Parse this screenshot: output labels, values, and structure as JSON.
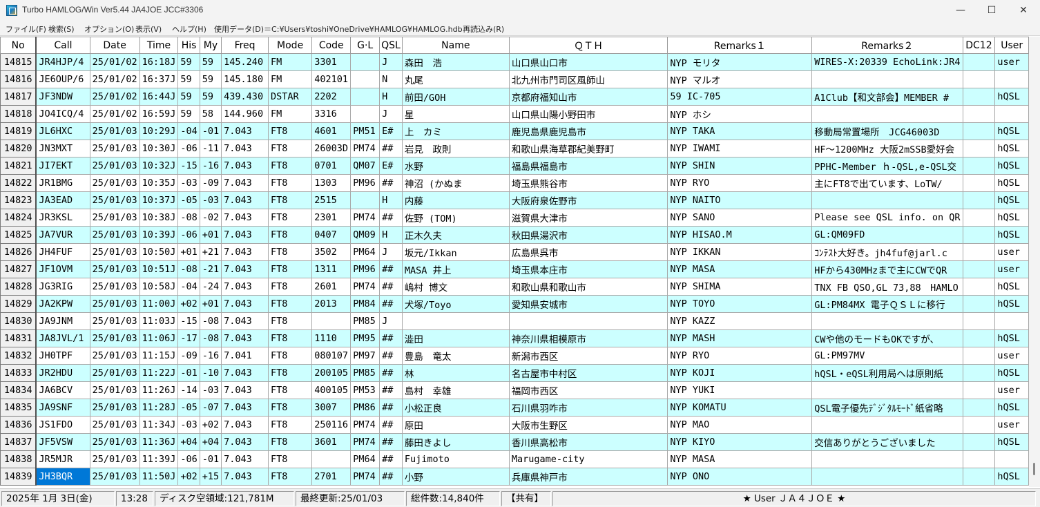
{
  "window": {
    "title": "Turbo HAMLOG/Win Ver5.44 JA4JOE JCC#3306",
    "minimize_glyph": "—",
    "maximize_glyph": "☐",
    "close_glyph": "✕"
  },
  "menu": [
    "ファイル(F)",
    "検索(S)",
    "オプション(O)",
    "表示(V)",
    "ヘルプ(H)",
    "使用データ(D)＝C:¥Users¥toshi¥OneDrive¥HAMLOG¥HAMLOG.hdb",
    "再読込み(R)"
  ],
  "table": {
    "columns": [
      "No",
      "Call",
      "Date",
      "Time",
      "His",
      "My",
      "Freq",
      "Mode",
      "Code",
      "G·L",
      "QSL",
      "Name",
      "ＱＴＨ",
      "Remarks１",
      "Remarks２",
      "DC12",
      "User"
    ],
    "rows": [
      [
        "14815",
        "JR4HJP/4",
        "25/01/02",
        "16:18J",
        "59",
        "59",
        "145.240",
        "FM",
        "3301",
        "",
        "J",
        "森田　浩",
        "山口県山口市",
        "NYP モリタ",
        "WIRES-X:20339 EchoLink:JR4",
        "",
        "user"
      ],
      [
        "14816",
        "JE6OUP/6",
        "25/01/02",
        "16:37J",
        "59",
        "59",
        "145.180",
        "FM",
        "402101",
        "",
        "N",
        "丸尾",
        "北九州市門司区風師山",
        "NYP マルオ",
        "",
        "",
        ""
      ],
      [
        "14817",
        "JF3NDW",
        "25/01/02",
        "16:44J",
        "59",
        "59",
        "439.430",
        "DSTAR",
        "2202",
        "",
        "H",
        "前田/GOH",
        "京都府福知山市",
        "59 IC-705",
        "A1Club【和文部会】MEMBER #",
        "",
        "hQSL"
      ],
      [
        "14818",
        "JO4ICQ/4",
        "25/01/02",
        "16:59J",
        "59",
        "58",
        "144.960",
        "FM",
        "3316",
        "",
        "J",
        "星",
        "山口県山陽小野田市",
        "NYP ホシ",
        "",
        "",
        ""
      ],
      [
        "14819",
        "JL6HXC",
        "25/01/03",
        "10:29J",
        "-04",
        "-01",
        "7.043",
        "FT8",
        "4601",
        "PM51",
        "E#",
        "上　カミ",
        "鹿児島県鹿児島市",
        "NYP TAKA",
        "移動局常置場所　JCG46003D",
        "",
        "hQSL"
      ],
      [
        "14820",
        "JN3MXT",
        "25/01/03",
        "10:30J",
        "-06",
        "-11",
        "7.043",
        "FT8",
        "26003D",
        "PM74",
        "##",
        "岩見　政則",
        "和歌山県海草郡紀美野町",
        "NYP IWAMI",
        "HF～1200MHz 大阪2mSSB愛好会",
        "",
        "hQSL"
      ],
      [
        "14821",
        "JI7EKT",
        "25/01/03",
        "10:32J",
        "-15",
        "-16",
        "7.043",
        "FT8",
        "0701",
        "QM07",
        "E#",
        "水野",
        "福島県福島市",
        "NYP SHIN",
        "PPHC-Member ｈ-QSL,e-QSL交",
        "",
        "hQSL"
      ],
      [
        "14822",
        "JR1BMG",
        "25/01/03",
        "10:35J",
        "-03",
        "-09",
        "7.043",
        "FT8",
        "1303",
        "PM96",
        "##",
        "神沼 (かぬま",
        "埼玉県熊谷市",
        "NYP RYO",
        "主にFT8で出ています、LoTW/",
        "",
        "hQSL"
      ],
      [
        "14823",
        "JA3EAD",
        "25/01/03",
        "10:37J",
        "-05",
        "-03",
        "7.043",
        "FT8",
        "2515",
        "",
        "H",
        "内藤",
        "大阪府泉佐野市",
        "NYP NAITO",
        "",
        "",
        "hQSL"
      ],
      [
        "14824",
        "JR3KSL",
        "25/01/03",
        "10:38J",
        "-08",
        "-02",
        "7.043",
        "FT8",
        "2301",
        "PM74",
        "##",
        "佐野 (TOM)",
        "滋賀県大津市",
        "NYP SANO",
        "Please see QSL info. on QR",
        "",
        "hQSL"
      ],
      [
        "14825",
        "JA7VUR",
        "25/01/03",
        "10:39J",
        "-06",
        "+01",
        "7.043",
        "FT8",
        "0407",
        "QM09",
        "H",
        "正木久夫",
        "秋田県湯沢市",
        "NYP HISAO.M",
        "GL:QM09FD",
        "",
        "hQSL"
      ],
      [
        "14826",
        "JH4FUF",
        "25/01/03",
        "10:50J",
        "+01",
        "+21",
        "7.043",
        "FT8",
        "3502",
        "PM64",
        "J",
        "坂元/Ikkan",
        "広島県呉市",
        "NYP IKKAN",
        "ｺﾝﾃｽﾄ大好き。jh4fuf@jarl.c",
        "",
        "user"
      ],
      [
        "14827",
        "JF1OVM",
        "25/01/03",
        "10:51J",
        "-08",
        "-21",
        "7.043",
        "FT8",
        "1311",
        "PM96",
        "##",
        "MASA 井上",
        "埼玉県本庄市",
        "NYP MASA",
        "HFから430MHzまで主にCWでQR",
        "",
        "user"
      ],
      [
        "14828",
        "JG3RIG",
        "25/01/03",
        "10:58J",
        "-04",
        "-24",
        "7.043",
        "FT8",
        "2601",
        "PM74",
        "##",
        "嶋村 博文",
        "和歌山県和歌山市",
        "NYP SHIMA",
        "TNX FB QSO,GL 73,88　HAMLO",
        "",
        "hQSL"
      ],
      [
        "14829",
        "JA2KPW",
        "25/01/03",
        "11:00J",
        "+02",
        "+01",
        "7.043",
        "FT8",
        "2013",
        "PM84",
        "##",
        "犬塚/Toyo",
        "愛知県安城市",
        "NYP TOYO",
        "GL:PM84MX 電子ＱＳＬに移行",
        "",
        "hQSL"
      ],
      [
        "14830",
        "JA9JNM",
        "25/01/03",
        "11:03J",
        "-15",
        "-08",
        "7.043",
        "FT8",
        "",
        "PM85",
        "J",
        "",
        "",
        "NYP KAZZ",
        "",
        "",
        ""
      ],
      [
        "14831",
        "JA8JVL/1",
        "25/01/03",
        "11:06J",
        "-17",
        "-08",
        "7.043",
        "FT8",
        "1110",
        "PM95",
        "##",
        "澁田",
        "神奈川県相模原市",
        "NYP MASH",
        "CWや他のモードもOKですが、",
        "",
        "hQSL"
      ],
      [
        "14832",
        "JH0TPF",
        "25/01/03",
        "11:15J",
        "-09",
        "-16",
        "7.041",
        "FT8",
        "080107",
        "PM97",
        "##",
        "豊島　竜太",
        "新潟市西区",
        "NYP RYO",
        "GL:PM97MV",
        "",
        "user"
      ],
      [
        "14833",
        "JR2HDU",
        "25/01/03",
        "11:22J",
        "-01",
        "-10",
        "7.043",
        "FT8",
        "200105",
        "PM85",
        "##",
        "林",
        "名古屋市中村区",
        "NYP KOJI",
        "hQSL・eQSL利用局へは原則紙",
        "",
        "hQSL"
      ],
      [
        "14834",
        "JA6BCV",
        "25/01/03",
        "11:26J",
        "-14",
        "-03",
        "7.043",
        "FT8",
        "400105",
        "PM53",
        "##",
        "島村　幸雄",
        "福岡市西区",
        "NYP YUKI",
        "",
        "",
        "user"
      ],
      [
        "14835",
        "JA9SNF",
        "25/01/03",
        "11:28J",
        "-05",
        "-07",
        "7.043",
        "FT8",
        "3007",
        "PM86",
        "##",
        "小松正良",
        "石川県羽咋市",
        "NYP KOMATU",
        "QSL電子優先ﾃﾞｼﾞﾀﾙﾓｰﾄﾞ紙省略",
        "",
        "hQSL"
      ],
      [
        "14836",
        "JS1FDO",
        "25/01/03",
        "11:34J",
        "-03",
        "+02",
        "7.043",
        "FT8",
        "250116",
        "PM74",
        "##",
        "原田",
        "大阪市生野区",
        "NYP MAO",
        "",
        "",
        "user"
      ],
      [
        "14837",
        "JF5VSW",
        "25/01/03",
        "11:36J",
        "+04",
        "+04",
        "7.043",
        "FT8",
        "3601",
        "PM74",
        "##",
        "藤田きよし",
        "香川県高松市",
        "NYP KIYO",
        "交信ありがとうございました",
        "",
        "hQSL"
      ],
      [
        "14838",
        "JR5MJR",
        "25/01/03",
        "11:39J",
        "-06",
        "-01",
        "7.043",
        "FT8",
        "",
        "PM64",
        "##",
        "Fujimoto",
        "Marugame-city",
        "NYP MASA",
        "",
        "",
        ""
      ],
      [
        "14839",
        "JH3BQR",
        "25/01/03",
        "11:50J",
        "+02",
        "+15",
        "7.043",
        "FT8",
        "2701",
        "PM74",
        "##",
        "小野",
        "兵庫県神戸市",
        "NYP ONO",
        "",
        "",
        "hQSL"
      ]
    ],
    "selected": {
      "row": 24,
      "col": 1
    }
  },
  "status": {
    "date": "2025年 1月 3日(金)",
    "time": "13:28",
    "disk": "ディスク空領域:121,781M",
    "updated": "最終更新:25/01/03",
    "total": "総件数:14,840件",
    "shared": "【共有】",
    "user": "★ User ＪＡ４ＪＯＥ ★"
  }
}
